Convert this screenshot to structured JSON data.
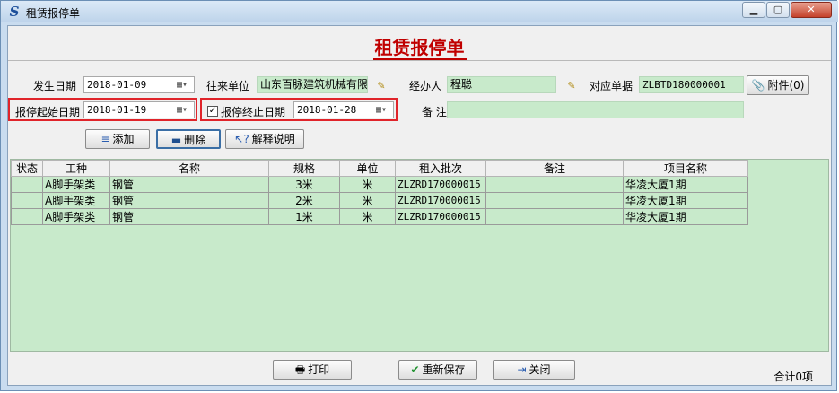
{
  "window": {
    "title": "租赁报停单",
    "controls": {
      "minimize": "▁",
      "maximize": "▢",
      "close": "✕"
    }
  },
  "form": {
    "heading": "租赁报停单",
    "occur_date": {
      "label": "发生日期",
      "value": "2018-01-09"
    },
    "partner": {
      "label": "往来单位",
      "value": "山东百脉建筑机械有限"
    },
    "handler": {
      "label": "经办人",
      "value": "程聪"
    },
    "ref_doc": {
      "label": "对应单据",
      "value": "ZLBTD180000001"
    },
    "attach_label": "附件(0)",
    "start_date": {
      "label": "报停起始日期",
      "value": "2018-01-19"
    },
    "end_date": {
      "label": "报停终止日期",
      "value": "2018-01-28",
      "checked": true
    },
    "note": {
      "label": "备  注",
      "value": ""
    }
  },
  "toolbar": {
    "add_label": "添加",
    "delete_label": "删除",
    "explain_label": "解释说明"
  },
  "table": {
    "columns": [
      "状态",
      "工种",
      "名称",
      "规格",
      "单位",
      "租入批次",
      "备注",
      "项目名称"
    ],
    "rows": [
      [
        "",
        "A脚手架类",
        "钢管",
        "3米",
        "米",
        "ZLZRD170000015",
        "",
        "华凌大厦1期"
      ],
      [
        "",
        "A脚手架类",
        "钢管",
        "2米",
        "米",
        "ZLZRD170000015",
        "",
        "华凌大厦1期"
      ],
      [
        "",
        "A脚手架类",
        "钢管",
        "1米",
        "米",
        "ZLZRD170000015",
        "",
        "华凌大厦1期"
      ]
    ]
  },
  "footer": {
    "print_label": "打印",
    "resave_label": "重新保存",
    "close_label": "关闭",
    "total_text": "合计0项"
  },
  "colors": {
    "accent_red": "#c00000",
    "highlight_box": "#e0242a",
    "readonly_green": "#c8eacb"
  }
}
